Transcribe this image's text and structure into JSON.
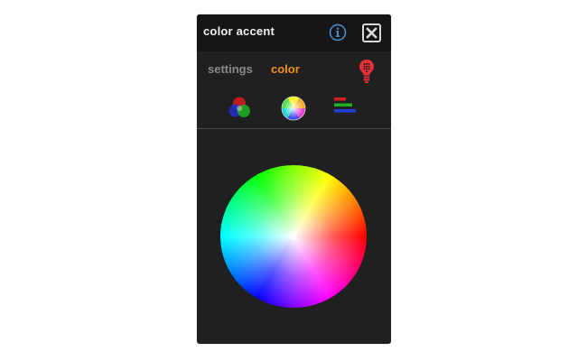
{
  "window": {
    "title": "color accent",
    "info_icon": "info-icon",
    "close_icon": "close-icon"
  },
  "tabs": [
    {
      "label": "settings",
      "active": false,
      "color": "#8a8a8a"
    },
    {
      "label": "color",
      "active": true,
      "color": "#f0931e"
    }
  ],
  "bulb_icon": {
    "name": "light-bulb-icon",
    "color": "#e8303a"
  },
  "color_modes": [
    {
      "name": "rgb-circles-icon",
      "active": false
    },
    {
      "name": "color-wheel-icon",
      "active": true
    },
    {
      "name": "rgb-sliders-icon",
      "active": false
    }
  ],
  "colors": {
    "panel_bg": "#202020",
    "titlebar_bg": "#151515",
    "info_accent": "#4a90d9",
    "active_tab": "#f0931e",
    "inactive_tab": "#8a8a8a"
  }
}
